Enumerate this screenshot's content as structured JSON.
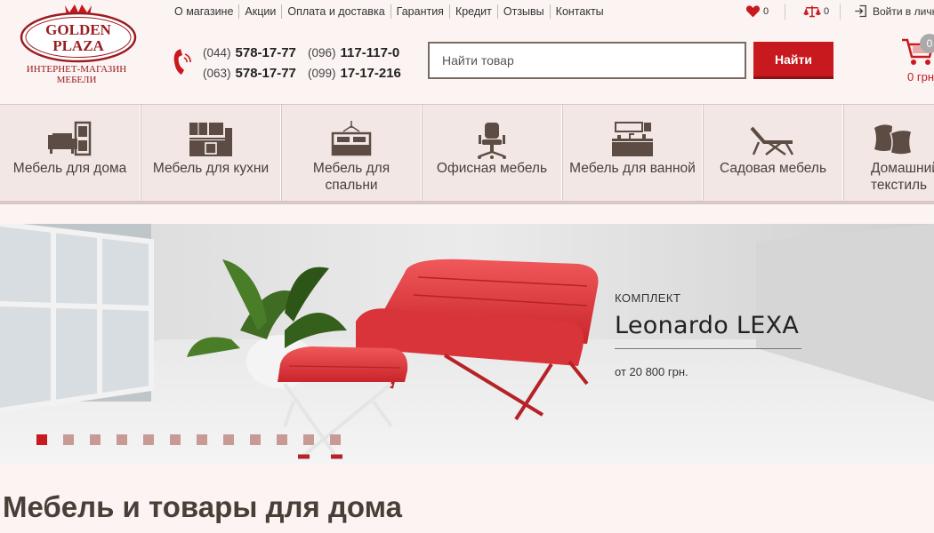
{
  "logo": {
    "line1": "GOLDEN",
    "line2": "PLAZA",
    "sub": "ИНТЕРНЕТ-МАГАЗИН МЕБЕЛИ"
  },
  "topnav": [
    "О магазине",
    "Акции",
    "Оплата и доставка",
    "Гарантия",
    "Кредит",
    "Отзывы",
    "Контакты"
  ],
  "favorites": {
    "icon": "heart-icon",
    "count": "0"
  },
  "compare": {
    "icon": "scales-icon",
    "count": "0"
  },
  "login": {
    "icon": "login-icon",
    "label": "Войти в личн"
  },
  "phones": [
    {
      "code": "(044)",
      "number": "578-17-77"
    },
    {
      "code": "(096)",
      "number": "117-117-0"
    },
    {
      "code": "(063)",
      "number": "578-17-77"
    },
    {
      "code": "(099)",
      "number": "17-17-216"
    }
  ],
  "search": {
    "placeholder": "Найти товар",
    "button": "Найти"
  },
  "cart": {
    "icon": "cart-icon",
    "badge": "0",
    "total": "0 грн"
  },
  "categories": [
    {
      "icon": "living-room-icon",
      "label": "Мебель для дома"
    },
    {
      "icon": "kitchen-icon",
      "label": "Мебель для кухни"
    },
    {
      "icon": "bedroom-icon",
      "label": "Мебель для спальни"
    },
    {
      "icon": "office-chair-icon",
      "label": "Офисная мебель"
    },
    {
      "icon": "bathroom-icon",
      "label": "Мебель для ванной"
    },
    {
      "icon": "lounger-icon",
      "label": "Садовая мебель"
    },
    {
      "icon": "pillows-icon",
      "label": "Домашний текстиль"
    }
  ],
  "banner": {
    "kit": "КОМПЛЕКТ",
    "name": "Leonardo LEXA",
    "price": "от 20 800 грн.",
    "slide_count": 12,
    "active_slide": 1
  },
  "page_title": "Мебель и товары для дома",
  "colors": {
    "brand_red": "#c8191f",
    "brown": "#4a3f38",
    "bg": "#fbf4f3"
  }
}
